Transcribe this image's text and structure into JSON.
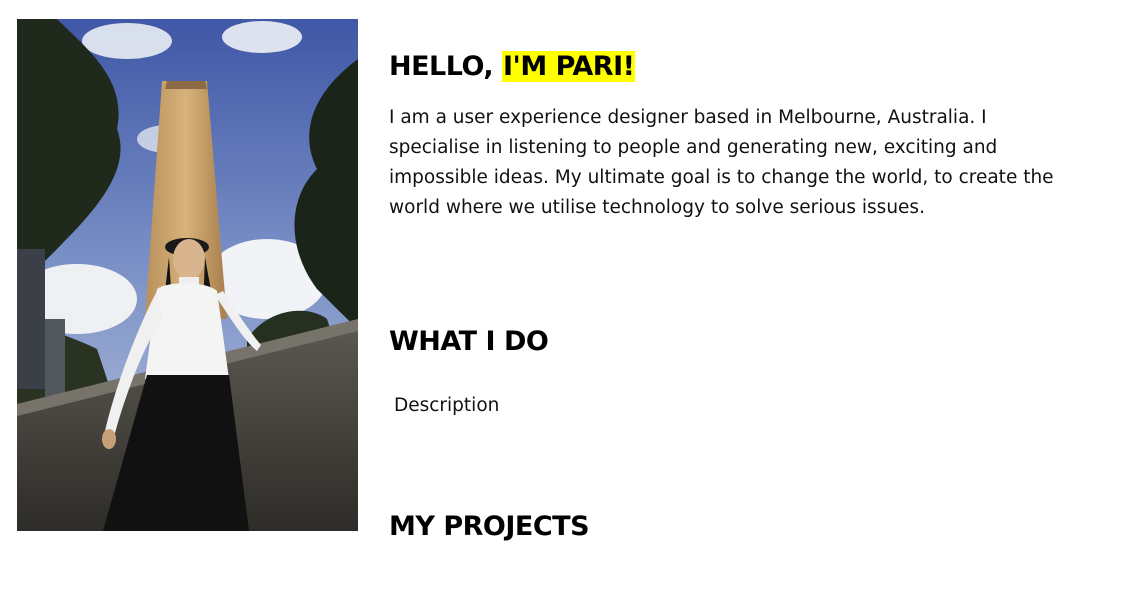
{
  "hero": {
    "greeting": "HELLO, ",
    "name_highlight": "I'M PARI!",
    "highlight_color": "#ffff00"
  },
  "intro": {
    "text": "I am a user experience designer based in Melbourne, Australia. I specialise in listening to people and generating new, exciting and impossible ideas. My ultimate goal is to change the world, to create the world where we utilise technology to solve serious issues."
  },
  "what_i_do": {
    "title": "WHAT I DO",
    "description": "Description"
  },
  "projects": {
    "title": "MY PROJECTS"
  }
}
